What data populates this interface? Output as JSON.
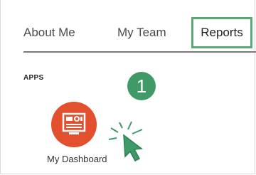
{
  "tabs": [
    {
      "label": "About Me"
    },
    {
      "label": "My Team"
    },
    {
      "label": "Reports",
      "selected": true
    }
  ],
  "apps_section": {
    "label": "APPS"
  },
  "step_badge": {
    "number": "1"
  },
  "apps": [
    {
      "label": "My Dashboard",
      "icon": "dashboard-icon"
    }
  ],
  "colors": {
    "highlight": "#5aa978",
    "badge": "#3f9a67",
    "app_icon_bg": "#e2502d",
    "cursor": "#3f9a67"
  }
}
